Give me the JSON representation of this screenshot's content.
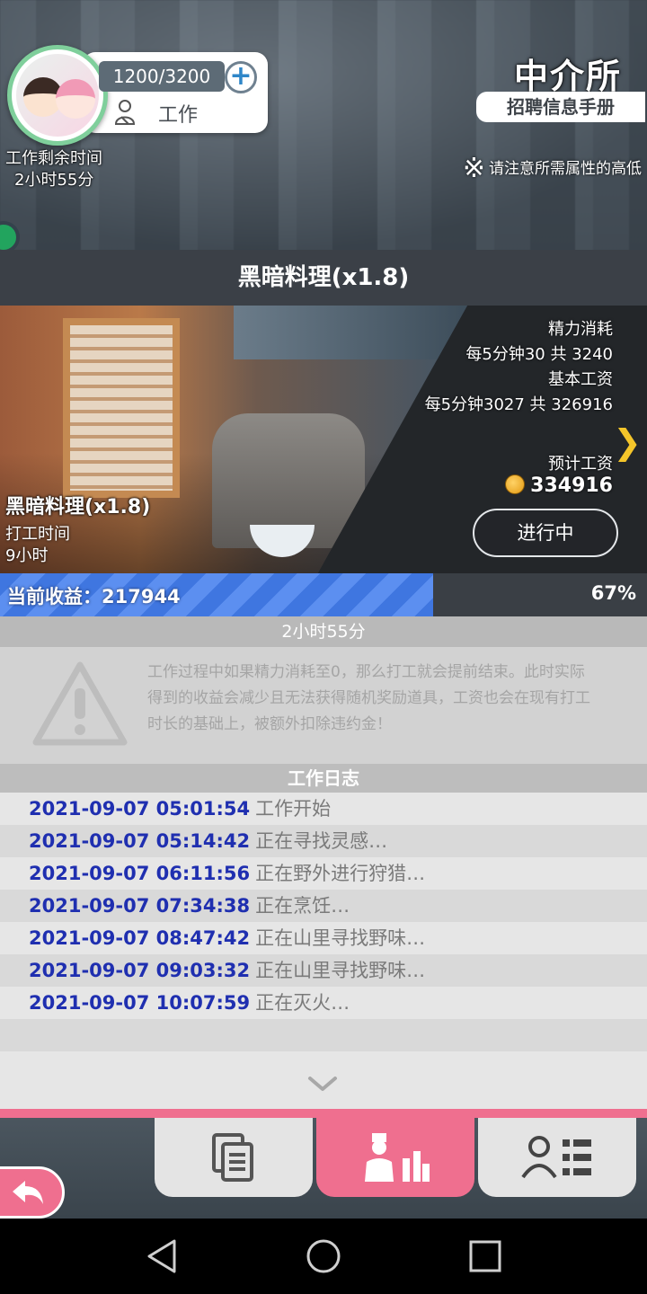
{
  "player": {
    "energy": "1200/3200",
    "job_label": "工作",
    "remaining_label": "工作剩余时间",
    "remaining_value": "2小时55分"
  },
  "agency": {
    "title": "中介所",
    "subtitle": "招聘信息手册",
    "note_mark": "※",
    "note_text": "请注意所需属性的高低"
  },
  "job": {
    "header": "黑暗料理(x1.8)",
    "card_name": "黑暗料理(x1.8)",
    "time_label": "打工时间",
    "time_value": "9小时",
    "stamina_label": "精力消耗",
    "stamina_value": "每5分钟30 共 3240",
    "base_wage_label": "基本工资",
    "base_wage_value": "每5分钟3027 共 326916",
    "expected_wage_label": "预计工资",
    "expected_wage_value": "334916",
    "status_button": "进行中"
  },
  "progress": {
    "label": "当前收益：217944",
    "percent_text": "67%",
    "fraction": 0.67,
    "remaining": "2小时55分"
  },
  "warning": {
    "text": "工作过程中如果精力消耗至0，那么打工就会提前结束。此时实际得到的收益会减少且无法获得随机奖励道具，工资也会在现有打工时长的基础上，被额外扣除违约金！"
  },
  "log": {
    "header": "工作日志",
    "entries": [
      {
        "time": "2021-09-07 05:01:54",
        "msg": "工作开始"
      },
      {
        "time": "2021-09-07 05:14:42",
        "msg": "正在寻找灵感…"
      },
      {
        "time": "2021-09-07 06:11:56",
        "msg": "正在野外进行狩猎…"
      },
      {
        "time": "2021-09-07 07:34:38",
        "msg": "正在烹饪…"
      },
      {
        "time": "2021-09-07 08:47:42",
        "msg": "正在山里寻找野味…"
      },
      {
        "time": "2021-09-07 09:03:32",
        "msg": "正在山里寻找野味…"
      },
      {
        "time": "2021-09-07 10:07:59",
        "msg": "正在灭火…"
      }
    ]
  },
  "nav": {
    "tabs": [
      {
        "icon": "document-icon",
        "active": false
      },
      {
        "icon": "worker-icon",
        "active": true
      },
      {
        "icon": "profile-list-icon",
        "active": false
      }
    ]
  },
  "colors": {
    "accent_pink": "#ef6f8f",
    "progress_blue": "#3f76e0",
    "log_time_blue": "#1f2fb0",
    "arrow_yellow": "#f4c52a"
  }
}
